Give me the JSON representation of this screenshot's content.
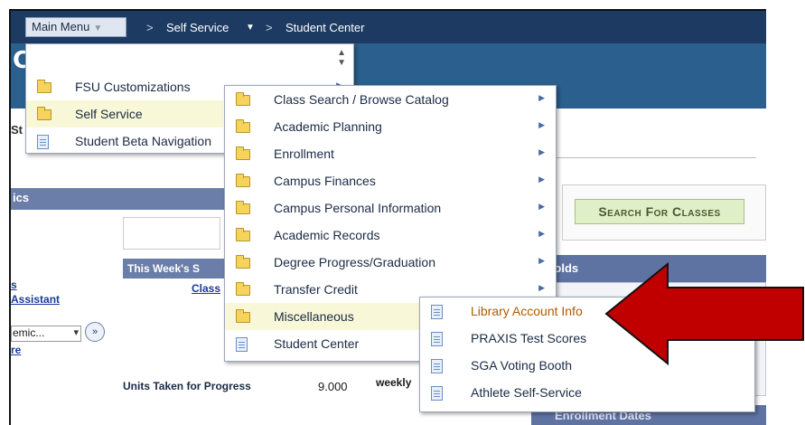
{
  "navbar": {
    "main_menu_label": "Main Menu",
    "crumbs": [
      "Self Service",
      "Student Center"
    ]
  },
  "header": {
    "title_fragment": "Cl"
  },
  "page": {
    "left_fragment": "St",
    "sidebar_header": "ics",
    "sidebar_links": [
      "s",
      "Assistant",
      "re"
    ],
    "select_value": "emic...",
    "week_header": "This Week's S",
    "class_fragment": "Class",
    "units_label": "Units Taken for Progress",
    "units_value": "9.000",
    "weekly_fragment": "weekly",
    "search_button": "Search For Classes",
    "holds_header": "Holds",
    "enroll_dates_header": "Enrollment Dates"
  },
  "menu_level1": [
    {
      "label": "FSU Customizations",
      "icon": "folder-icon",
      "submenu": true
    },
    {
      "label": "Self Service",
      "icon": "folder-icon",
      "submenu": true,
      "highlighted": true
    },
    {
      "label": "Student Beta Navigation",
      "icon": "document-icon",
      "submenu": false
    }
  ],
  "menu_level2": [
    {
      "label": "Class Search / Browse Catalog",
      "icon": "folder-icon",
      "submenu": true
    },
    {
      "label": "Academic Planning",
      "icon": "folder-icon",
      "submenu": true
    },
    {
      "label": "Enrollment",
      "icon": "folder-icon",
      "submenu": true
    },
    {
      "label": "Campus Finances",
      "icon": "folder-icon",
      "submenu": true
    },
    {
      "label": "Campus Personal Information",
      "icon": "folder-icon",
      "submenu": true
    },
    {
      "label": "Academic Records",
      "icon": "folder-icon",
      "submenu": true
    },
    {
      "label": "Degree Progress/Graduation",
      "icon": "folder-icon",
      "submenu": true
    },
    {
      "label": "Transfer Credit",
      "icon": "folder-icon",
      "submenu": true
    },
    {
      "label": "Miscellaneous",
      "icon": "folder-icon",
      "submenu": true,
      "highlighted": true
    },
    {
      "label": "Student Center",
      "icon": "document-icon",
      "submenu": false
    }
  ],
  "menu_level3": [
    {
      "label": "Library Account Info",
      "icon": "document-icon",
      "highlighted": true
    },
    {
      "label": "PRAXIS Test Scores",
      "icon": "document-icon"
    },
    {
      "label": "SGA Voting Booth",
      "icon": "document-icon"
    },
    {
      "label": "Athlete Self-Service",
      "icon": "document-icon"
    }
  ],
  "colors": {
    "navbar": "#1d3a62",
    "header_band": "#2b5f8d",
    "highlight": "#f8f8d8",
    "arrow": "#c00000",
    "section_header": "#5f73a2"
  }
}
